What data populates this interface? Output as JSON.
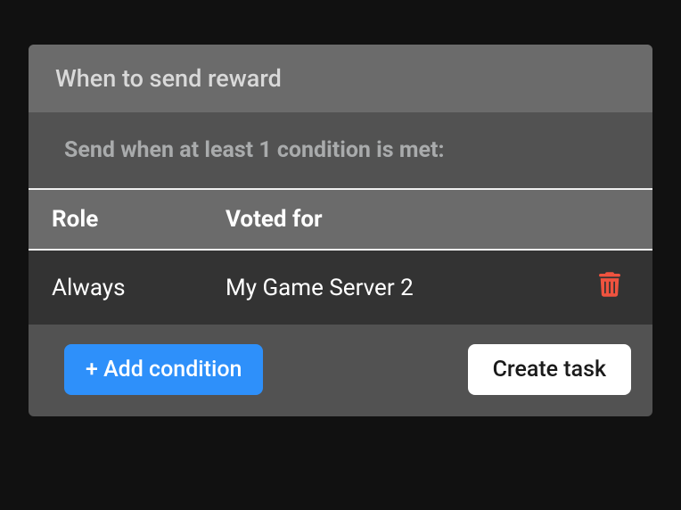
{
  "header": {
    "title": "When to send reward"
  },
  "subtitle": "Send when at least 1 condition is met:",
  "table": {
    "columns": {
      "role": "Role",
      "voted": "Voted for"
    },
    "rows": [
      {
        "role": "Always",
        "voted": "My Game Server 2"
      }
    ]
  },
  "actions": {
    "add_condition": "+ Add condition",
    "create_task": "Create task"
  }
}
